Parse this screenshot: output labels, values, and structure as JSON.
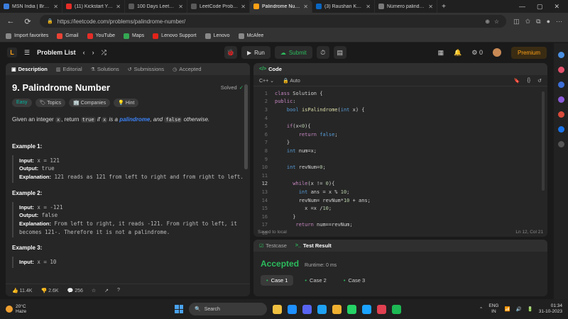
{
  "browser": {
    "tabs": [
      {
        "label": "MSN India | Breaking",
        "color": "#3b7ddd",
        "active": false
      },
      {
        "label": "(11) Kickstart Your C",
        "color": "#e52d27",
        "active": false
      },
      {
        "label": "100 Days LeetCode",
        "color": "#5a5a5a",
        "active": false
      },
      {
        "label": "LeetCode Problem",
        "color": "#5a5a5a",
        "active": false
      },
      {
        "label": "Palindrome Number",
        "color": "#ffa116",
        "active": true
      },
      {
        "label": "(3) Raushan Kumar |",
        "color": "#0a66c2",
        "active": false
      },
      {
        "label": "Número palindromo",
        "color": "#7a7a7a",
        "active": false
      }
    ],
    "new_tab": "+",
    "url": "https://leetcode.com/problems/palindrome-number/",
    "bookmarks": [
      {
        "label": "Import favorites",
        "color": "#888"
      },
      {
        "label": "Gmail",
        "color": "#ea4335"
      },
      {
        "label": "YouTube",
        "color": "#e52d27"
      },
      {
        "label": "Maps",
        "color": "#34a853"
      },
      {
        "label": "Lenovo Support",
        "color": "#e2231a"
      },
      {
        "label": "Lenovo",
        "color": "#888"
      },
      {
        "label": "McAfee",
        "color": "#888"
      }
    ]
  },
  "leetcode": {
    "logo": "L",
    "problem_list": "Problem List",
    "run": "Run",
    "submit": "Submit",
    "points": "0",
    "premium": "Premium"
  },
  "description": {
    "tabs": [
      "Description",
      "Editorial",
      "Solutions",
      "Submissions",
      "Accepted"
    ],
    "title": "9. Palindrome Number",
    "solved": "Solved",
    "tags": [
      "Easy",
      "Topics",
      "Companies",
      "Hint"
    ],
    "stmt_pre": "Given an integer",
    "stmt_x": "x",
    "stmt_mid": ", return",
    "stmt_true": "true",
    "stmt_if": "if",
    "stmt_x2": "x",
    "stmt_is": "is a",
    "stmt_link": "palindrome",
    "stmt_and": ", and",
    "stmt_false": "false",
    "stmt_otherwise": "otherwise.",
    "examples": [
      {
        "title": "Example 1:",
        "input": "x = 121",
        "output": "true",
        "explanation": "121 reads as 121 from left to right and from right to left."
      },
      {
        "title": "Example 2:",
        "input": "x = -121",
        "output": "false",
        "explanation": "From left to right, it reads -121. From right to left, it becomes 121-. Therefore it is not a palindrome."
      },
      {
        "title": "Example 3:",
        "input": "x = 10"
      }
    ],
    "labels": {
      "input": "Input:",
      "output": "Output:",
      "explanation": "Explanation:"
    },
    "footer": {
      "likes": "11.4K",
      "dislikes": "2.6K",
      "comments": "256"
    }
  },
  "code": {
    "tab": "Code",
    "language": "C++",
    "auto": "Auto",
    "lines": [
      "class Solution {",
      "public:",
      "    bool isPalindrome(int x) {",
      "",
      "    if(x<0){",
      "        return false;",
      "    }",
      "    int num=x;",
      "",
      "    int revNum=0;",
      "",
      "      while(x != 0){",
      "        int ans = x % 10;",
      "        revNum= revNum*10 + ans;",
      "          x =x /10;",
      "      }",
      "       return num==revNum;",
      ""
    ],
    "current_line": 12,
    "saved": "Saved to local",
    "position": "Ln 12, Col 21"
  },
  "result": {
    "tabs": [
      "Testcase",
      "Test Result"
    ],
    "status": "Accepted",
    "runtime": "Runtime: 0 ms",
    "cases": [
      "Case 1",
      "Case 2",
      "Case 3"
    ]
  },
  "taskbar": {
    "temp": "20°C",
    "weather": "Haze",
    "search": "Search",
    "lang1": "ENG",
    "lang2": "IN",
    "time": "01:34",
    "date": "31-10-2023",
    "apps": [
      "#f0c040",
      "#1e90ff",
      "#5865f2",
      "#1fa1f1",
      "#f0b030",
      "#25d366",
      "#1aa3ff",
      "#e04050",
      "#1db954"
    ]
  }
}
